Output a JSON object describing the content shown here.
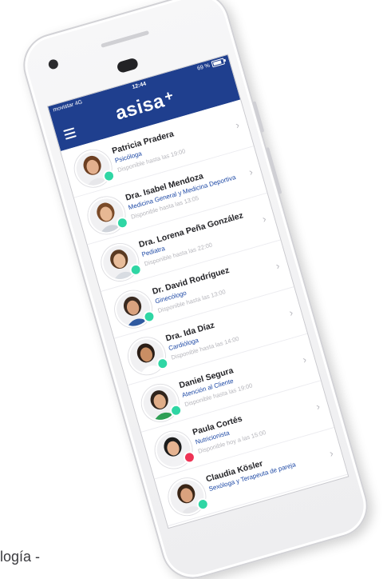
{
  "status_bar": {
    "carrier": "movistar 4G",
    "time": "12:44",
    "battery": "69 %"
  },
  "header": {
    "logo": "asisa",
    "logo_mark": "+"
  },
  "professionals": [
    {
      "name": "Patricia Pradera",
      "specialty": "Psicóloga",
      "availability": "Disponible hasta las 19:00",
      "status": "online"
    },
    {
      "name": "Dra. Isabel Mendoza",
      "specialty": "Medicina General y Medicina Deportiva",
      "availability": "Disponible hasta las 13:05",
      "status": "online"
    },
    {
      "name": "Dra. Lorena Peña González",
      "specialty": "Pediatra",
      "availability": "Disponible hasta las 22:00",
      "status": "online"
    },
    {
      "name": "Dr. David Rodríguez",
      "specialty": "Ginecólogo",
      "availability": "Disponible hasta las 13:00",
      "status": "online"
    },
    {
      "name": "Dra. Ida Díaz",
      "specialty": "Cardióloga",
      "availability": "Disponible hasta las 14:00",
      "status": "online"
    },
    {
      "name": "Daniel Segura",
      "specialty": "Atención al Cliente",
      "availability": "Disponible hasta las 19:00",
      "status": "online"
    },
    {
      "name": "Paula Cortés",
      "specialty": "Nutricionista",
      "availability": "Disponible hoy a las 15:00",
      "status": "offline"
    },
    {
      "name": "Claudia Kösler",
      "specialty": "Sexóloga y Terapeuta de pareja",
      "availability": "",
      "status": "online"
    }
  ],
  "caption": "logía -",
  "colors": {
    "brand_blue": "#1f3f8e",
    "specialty_blue": "#1f4aa6",
    "online": "#2fd6a4",
    "offline": "#ee3355"
  },
  "icons": {
    "menu": "hamburger-icon",
    "row_arrow": "chevron-right-icon"
  }
}
